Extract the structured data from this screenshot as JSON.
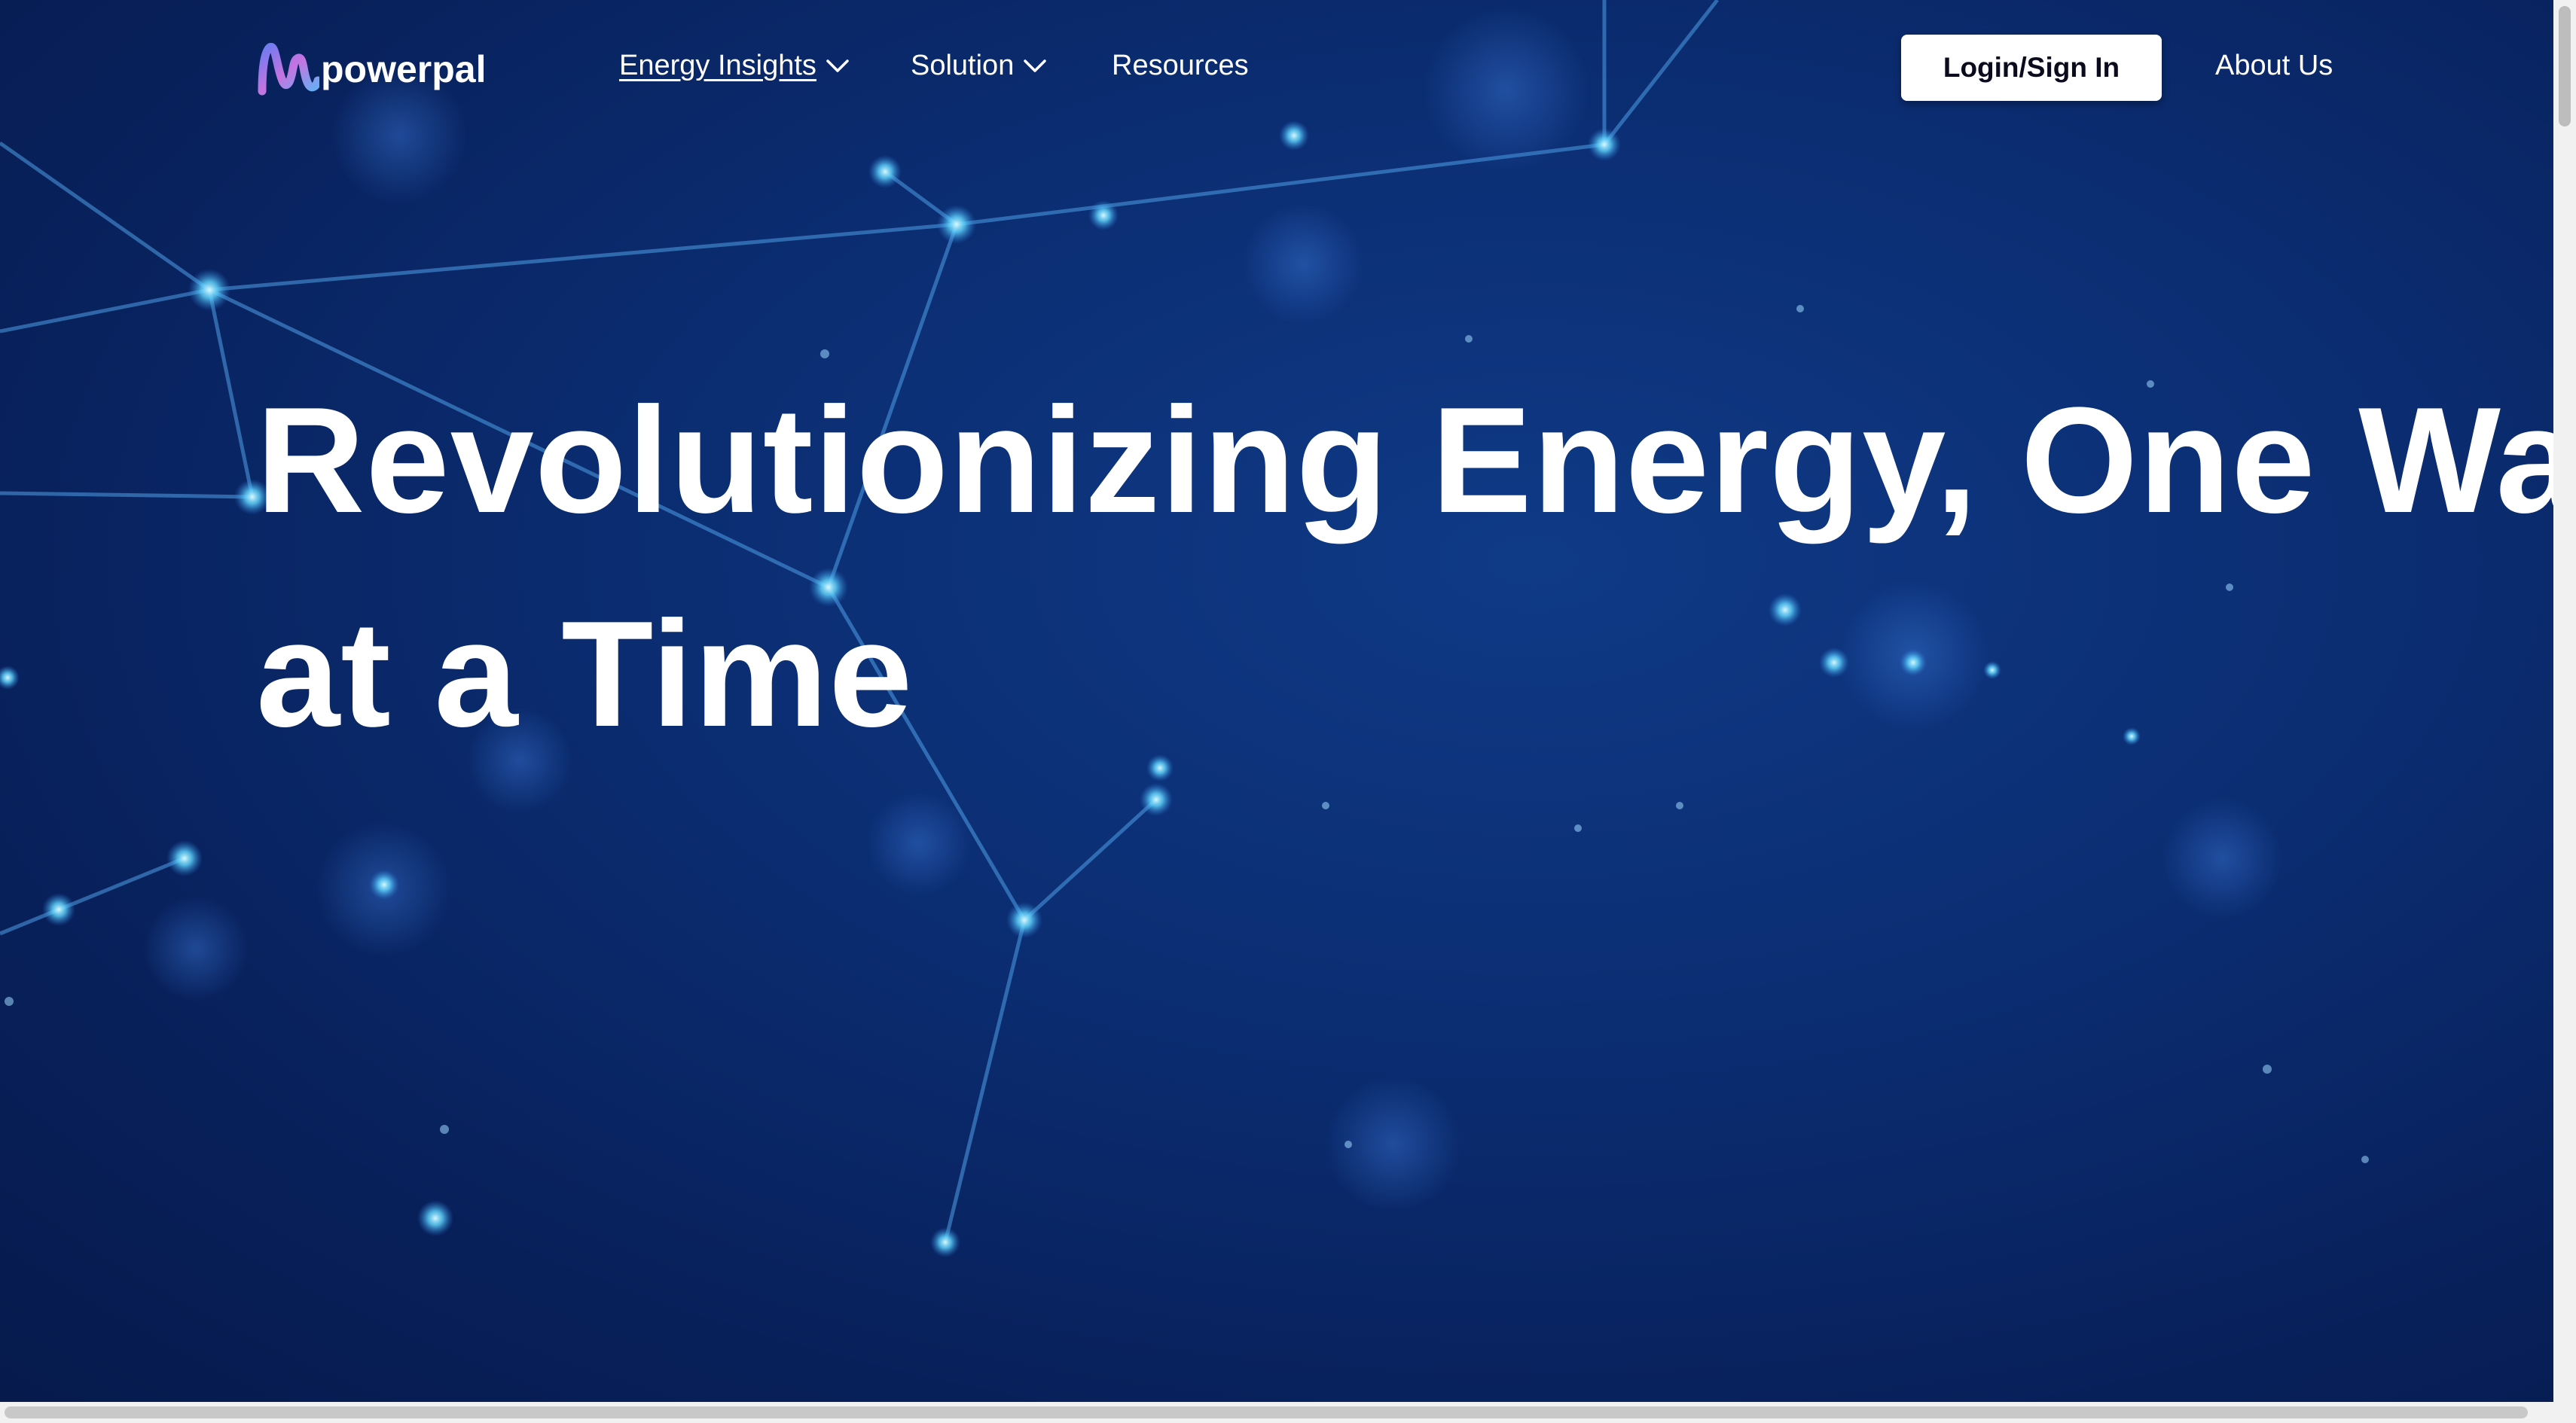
{
  "brand": {
    "name": "powerpal",
    "logo_icon": "powerpal-wave-logo"
  },
  "nav": {
    "items": [
      {
        "label": "Energy Insights",
        "icon": "chevron-down-icon"
      },
      {
        "label": "Solution",
        "icon": "chevron-down-icon"
      },
      {
        "label": "Resources"
      }
    ],
    "login_label": "Login/Sign In",
    "about_label": "About Us"
  },
  "hero": {
    "line1": "Revolutionizing Energy, One Watt",
    "line2": "at a Time"
  },
  "colors": {
    "background": "#0b2d72",
    "node": "#7fe3ff",
    "text": "#ffffff",
    "button_bg": "#ffffff",
    "button_text": "#0b0b1e"
  }
}
